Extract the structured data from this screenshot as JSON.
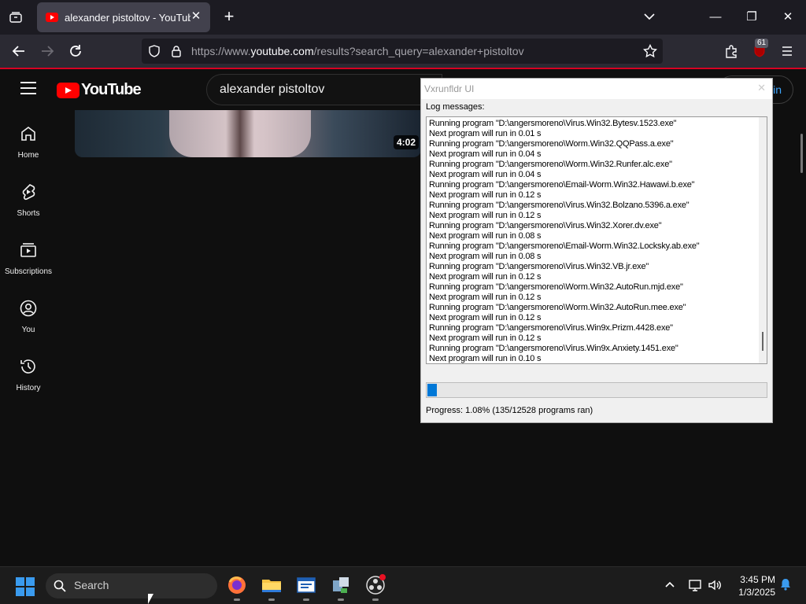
{
  "browser": {
    "tab_title": "alexander pistoltov - YouTube",
    "url_prefix": "https://www.",
    "url_domain": "youtube.com",
    "url_rest": "/results?search_query=alexander+pistoltov",
    "extensions_badge": "61"
  },
  "youtube": {
    "logo_text": "YouTube",
    "search_value": "alexander pistoltov",
    "signin_label": "in",
    "sidebar": [
      {
        "label": "Home",
        "icon": "home-icon"
      },
      {
        "label": "Shorts",
        "icon": "shorts-icon"
      },
      {
        "label": "Subscriptions",
        "icon": "subscriptions-icon"
      },
      {
        "label": "You",
        "icon": "you-icon"
      },
      {
        "label": "History",
        "icon": "history-icon"
      }
    ],
    "video_duration": "4:02"
  },
  "vx_window": {
    "title": "Vxrunfldr UI",
    "log_label": "Log messages:",
    "log_lines": [
      "Running program \"D:\\angersmoreno\\Virus.Win32.Bytesv.1523.exe\"",
      "Next program will run in 0.01 s",
      "Running program \"D:\\angersmoreno\\Worm.Win32.QQPass.a.exe\"",
      "Next program will run in 0.04 s",
      "Running program \"D:\\angersmoreno\\Worm.Win32.Runfer.alc.exe\"",
      "Next program will run in 0.04 s",
      "Running program \"D:\\angersmoreno\\Email-Worm.Win32.Hawawi.b.exe\"",
      "Next program will run in 0.12 s",
      "Running program \"D:\\angersmoreno\\Virus.Win32.Bolzano.5396.a.exe\"",
      "Next program will run in 0.12 s",
      "Running program \"D:\\angersmoreno\\Virus.Win32.Xorer.dv.exe\"",
      "Next program will run in 0.08 s",
      "Running program \"D:\\angersmoreno\\Email-Worm.Win32.Locksky.ab.exe\"",
      "Next program will run in 0.08 s",
      "Running program \"D:\\angersmoreno\\Virus.Win32.VB.jr.exe\"",
      "Next program will run in 0.12 s",
      "Running program \"D:\\angersmoreno\\Worm.Win32.AutoRun.mjd.exe\"",
      "Next program will run in 0.12 s",
      "Running program \"D:\\angersmoreno\\Worm.Win32.AutoRun.mee.exe\"",
      "Next program will run in 0.12 s",
      "Running program \"D:\\angersmoreno\\Virus.Win9x.Prizm.4428.exe\"",
      "Next program will run in 0.12 s",
      "Running program \"D:\\angersmoreno\\Virus.Win9x.Anxiety.1451.exe\"",
      "Next program will run in 0.10 s"
    ],
    "progress_fraction": 0.0108,
    "progress_text": "Progress: 1.08% (135/12528 programs ran)",
    "progress_color": "#0078d7"
  },
  "taskbar": {
    "search_label": "Search",
    "time": "3:45 PM",
    "date": "1/3/2025",
    "apps": [
      "firefox-icon",
      "file-explorer-icon",
      "vxrunfldr-app-icon",
      "network-tool-icon",
      "obs-icon"
    ]
  }
}
